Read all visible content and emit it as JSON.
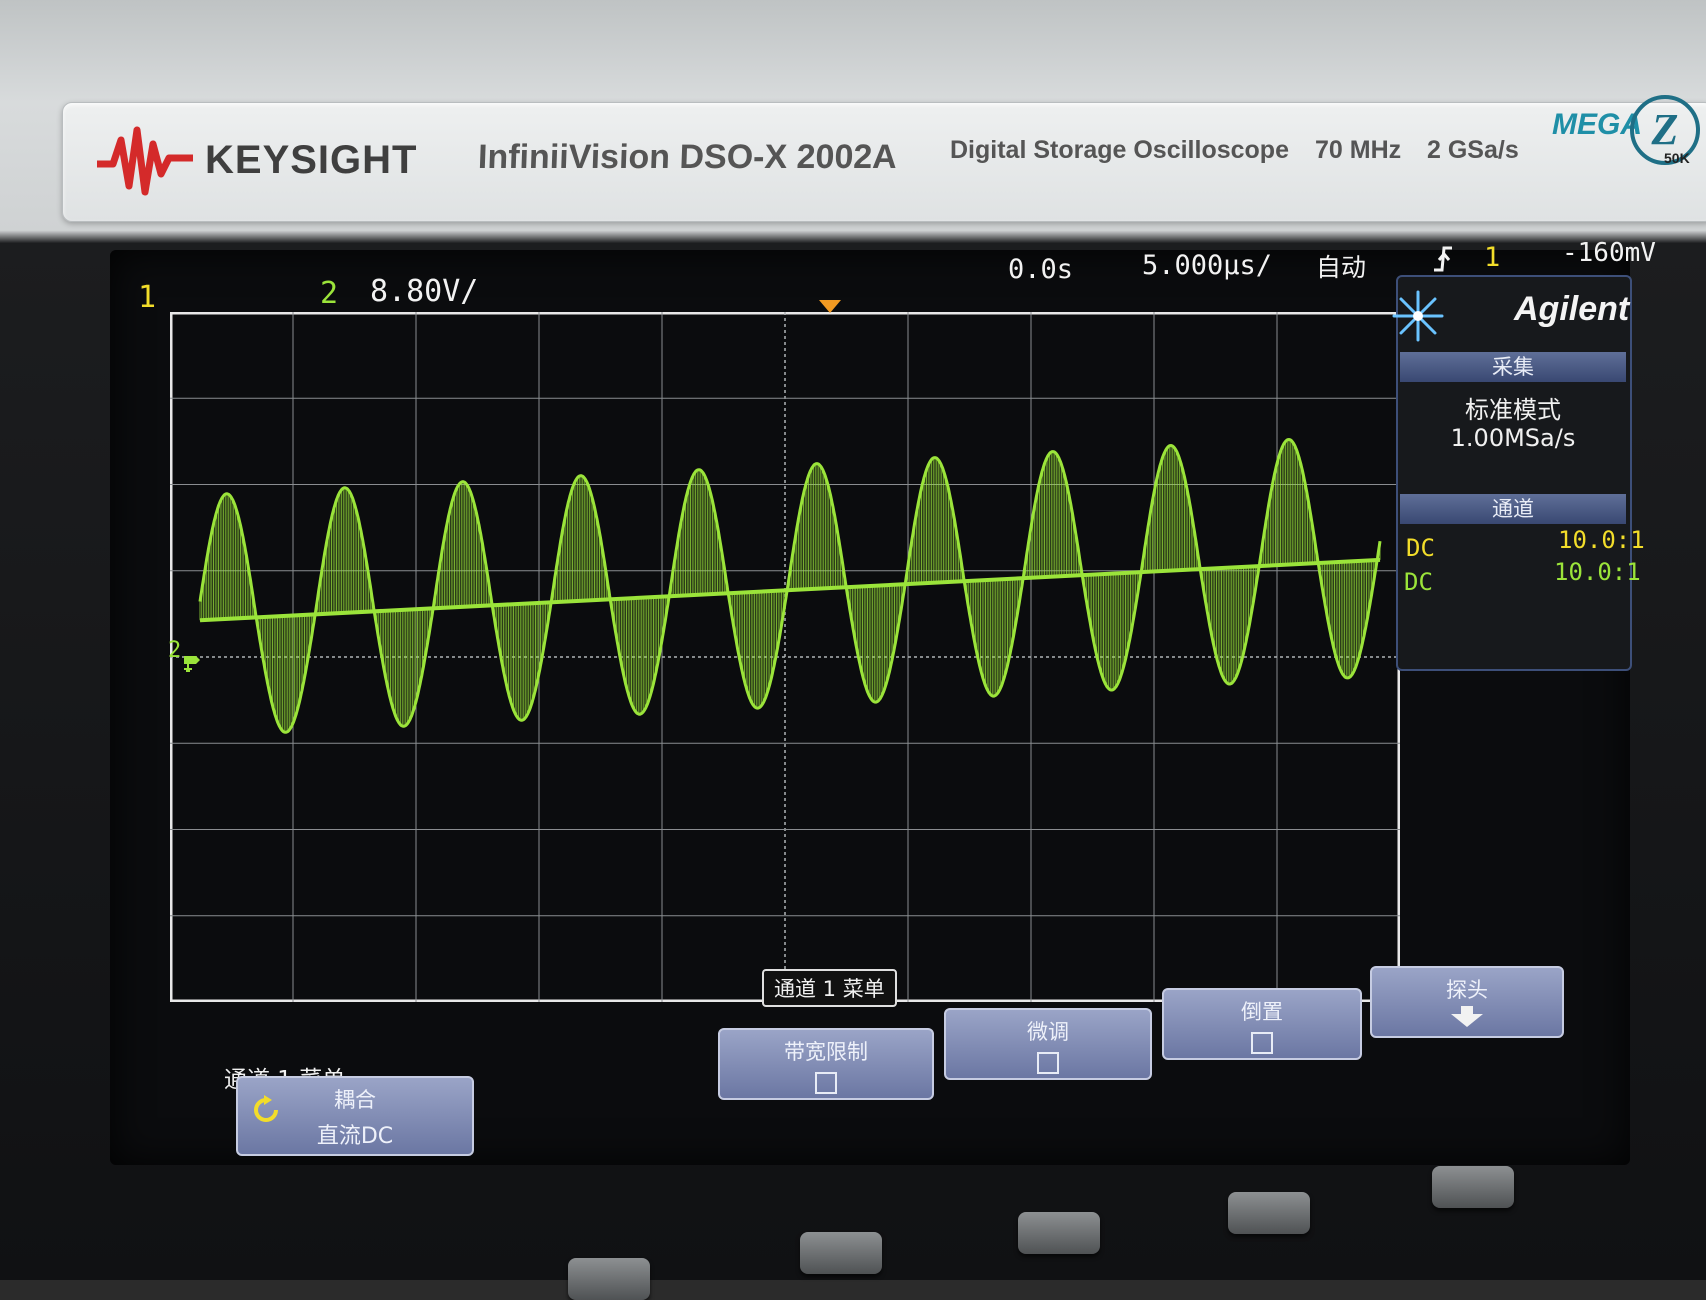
{
  "instrument": {
    "brand": "KEYSIGHT",
    "model": "InfiniiVision DSO-X 2002A",
    "description": "Digital Storage Oscilloscope",
    "bandwidth": "70 MHz",
    "sample_rate": "2 GSa/s",
    "zoom_brand": "MEGA",
    "zoom_letter": "Z",
    "zoom_sub": "50K"
  },
  "status_bar": {
    "ch1_label": "1",
    "ch2_label": "2",
    "ch2_scale": "8.80V/",
    "time_delay": "0.0s",
    "time_base": "5.000µs/",
    "trigger_mode": "自动",
    "trigger_source": "1",
    "trigger_level": "-160mV"
  },
  "side_panel": {
    "logo": "Agilent",
    "acquire_header": "采集",
    "acquire_mode": "标准模式",
    "acquire_rate": "1.00MSa/s",
    "channel_header": "通道",
    "channels": [
      {
        "coupling": "DC",
        "probe": "10.0:1",
        "color": "#f2dd2a"
      },
      {
        "coupling": "DC",
        "probe": "10.0:1",
        "color": "#9be43a"
      }
    ]
  },
  "menu": {
    "tab_label": "通道 1 菜单",
    "title": "通道 1 菜单",
    "softkeys": [
      {
        "label": "耦合",
        "value": "直流DC"
      },
      {
        "label": "带宽限制"
      },
      {
        "label": "微调"
      },
      {
        "label": "倒置"
      },
      {
        "label": "探头"
      }
    ]
  },
  "waveform": {
    "channel": "2",
    "color": "#9be43a",
    "cycles_visible": 10,
    "upper_envelope_divs": 1.45,
    "lower_envelope_divs": 1.35
  },
  "colors": {
    "ch1": "#f2dd2a",
    "ch2": "#9be43a",
    "grid": "#8a8d90",
    "softkey": "#7c87b1"
  }
}
